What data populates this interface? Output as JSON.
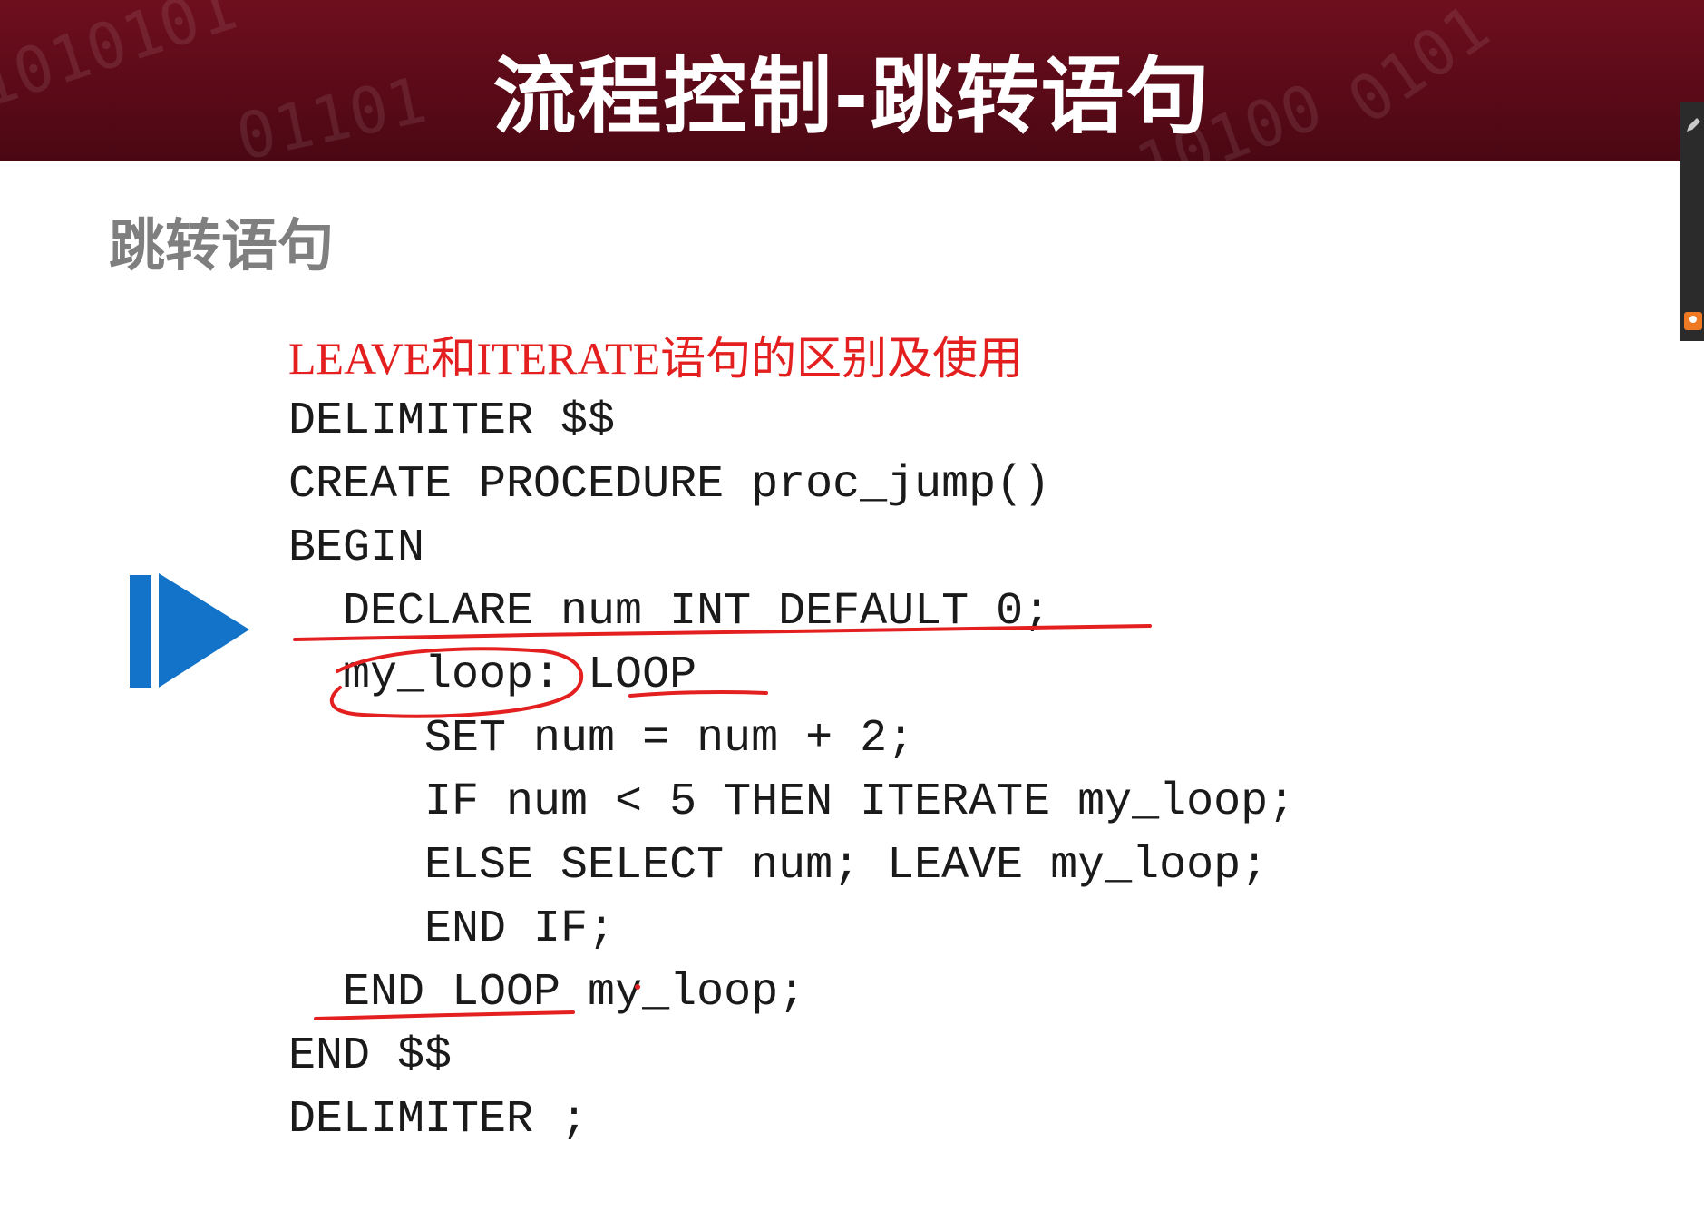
{
  "slide": {
    "title": "流程控制-跳转语句",
    "subheading": "跳转语句",
    "header_bits": [
      "1010101",
      "0101",
      "01101",
      "10100"
    ],
    "code_heading": "LEAVE和ITERATE语句的区别及使用",
    "code_lines": [
      "DELIMITER $$",
      "CREATE PROCEDURE proc_jump()",
      "BEGIN",
      "  DECLARE num INT DEFAULT 0;",
      "  my_loop: LOOP",
      "     SET num = num + 2;",
      "     IF num < 5 THEN ITERATE my_loop;",
      "     ELSE SELECT num; LEAVE my_loop;",
      "     END IF;",
      "  END LOOP my_loop;",
      "END $$",
      "DELIMITER ;"
    ]
  },
  "colors": {
    "header": "#5b0a18",
    "title_text": "#ffffff",
    "subheading_text": "#7f7f7f",
    "code_text": "#1a1a1a",
    "highlight": "#e41f1f",
    "play_icon": "#1273c9"
  },
  "icons": {
    "play": "play-forward-icon"
  }
}
